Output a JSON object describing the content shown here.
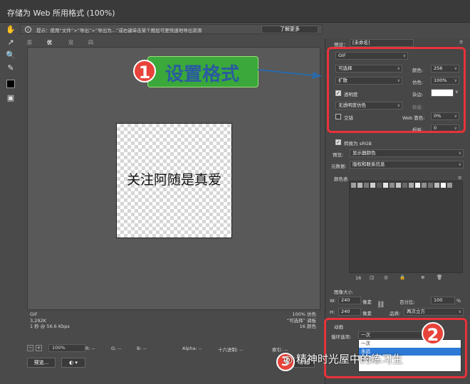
{
  "window": {
    "title": "存储为 Web 所用格式 (100%)"
  },
  "hint": {
    "text": "提示：使用“文件”>“导出”>“导出为...”或右键单击某个图层可更快速地导出资源",
    "button": "了解更多"
  },
  "tabs": [
    "原稿",
    "优化",
    "双联",
    "四联"
  ],
  "canvas": {
    "image_text": "关注阿随是真爱",
    "info_left": [
      "GIF",
      "3,292K",
      "1 秒 @ 56.6 Kbps"
    ],
    "info_right": [
      "100% 仿色",
      "“可选择” 调板",
      "16 颜色"
    ]
  },
  "status": {
    "zoom": "100%",
    "r": "R: --",
    "g": "G: --",
    "b": "B: --",
    "alpha": "Alpha: --",
    "hex": "十六进制: --",
    "index": "索引: --"
  },
  "bottom": {
    "preview": "预览...",
    "save": "存储"
  },
  "panel": {
    "preset_label": "预设：",
    "preset_value": "[未命名]",
    "format": "GIF",
    "palette": "可选择",
    "colors_label": "颜色:",
    "colors_value": "256",
    "dither_algo": "扩散",
    "dither_label": "仿色:",
    "dither_value": "100%",
    "transparency": "透明度",
    "matte_label": "杂边:",
    "trans_dither": "无透明度仿色",
    "amount_label": "数量:",
    "interlaced": "交错",
    "web_snap_label": "Web 靠色:",
    "web_snap_value": "0%",
    "lossy_label": "损耗:",
    "lossy_value": "0",
    "convert_srgb": "转换为 sRGB",
    "preview_label": "预览:",
    "preview_value": "显示器颜色",
    "metadata_label": "元数据:",
    "metadata_value": "版权和联系信息",
    "color_table_label": "颜色表",
    "color_count": "16",
    "image_size_label": "图像大小",
    "w_label": "W:",
    "w_value": "240",
    "h_label": "H:",
    "h_value": "240",
    "unit": "像素",
    "percent_label": "百分比:",
    "percent_value": "100",
    "percent_unit": "%",
    "quality_label": "品质:",
    "quality_value": "两次立方",
    "animation_label": "动画",
    "loop_label": "循环选项:",
    "loop_value": "一次",
    "loop_options": [
      "一次",
      "永远",
      "其它..."
    ],
    "frame_counter": "46"
  },
  "annotations": {
    "callout1_num": "1",
    "callout1_text": "设置格式",
    "callout2_num": "2",
    "callout3_num": "3"
  },
  "watermark": "精神时光屋中的练习生",
  "colors": {
    "accent_red": "#e8323a",
    "callout_green": "#3aa83a",
    "callout_text": "#2a5aa0",
    "selection_blue": "#2d7ad6"
  },
  "color_table": [
    "#a0a0a0",
    "#b8b8b8",
    "#7a7a7a",
    "#d0d0d0",
    "#5e5e5e",
    "#e6e6e6",
    "#8c8c8c",
    "#c4c4c4",
    "#686868",
    "#ababab",
    "#f0f0f0",
    "#909090",
    "#737373",
    "#bdbdbd",
    "#ffffff",
    "#999999"
  ]
}
